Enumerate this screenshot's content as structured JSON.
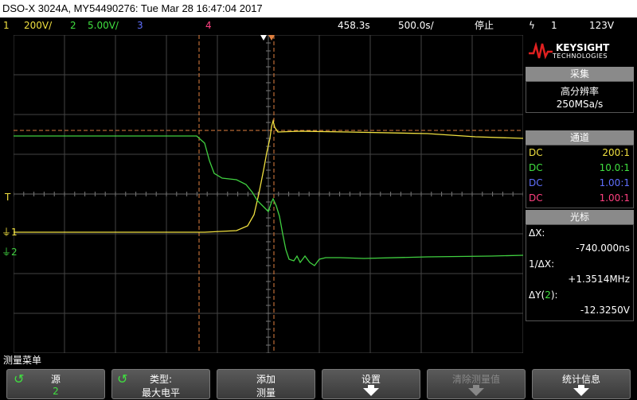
{
  "title_bar": "DSO-X 3024A, MY54490276: Tue Mar 28 16:47:04 2017",
  "status": {
    "ch1_num": "1",
    "ch1_scale": "200V/",
    "ch2_num": "2",
    "ch2_scale": "5.00V/",
    "ch3_num": "3",
    "ch4_num": "4",
    "time_delay": "458.3s",
    "time_scale": "500.0s/",
    "run_state": "停止",
    "trigger_icon": "trigger-edge-icon",
    "trigger_ch": "1",
    "trigger_level": "123V"
  },
  "brand": {
    "name": "KEYSIGHT",
    "sub": "TECHNOLOGIES"
  },
  "acquire": {
    "header": "采集",
    "mode": "高分辨率",
    "rate": "250MSa/s"
  },
  "channels": {
    "header": "通道",
    "rows": [
      {
        "coupling": "DC",
        "probe": "200:1",
        "color": "#f0e040"
      },
      {
        "coupling": "DC",
        "probe": "10.0:1",
        "color": "#40e040"
      },
      {
        "coupling": "DC",
        "probe": "1.00:1",
        "color": "#6070ff"
      },
      {
        "coupling": "DC",
        "probe": "1.00:1",
        "color": "#ff4080"
      }
    ]
  },
  "cursors": {
    "header": "光标",
    "dx_label": "ΔX:",
    "dx_value": "-740.000ns",
    "inv_dx_label": "1/ΔX:",
    "inv_dx_value": "+1.3514MHz",
    "dy_label_pre": "ΔY(",
    "dy_label_ch": "2",
    "dy_label_post": "):",
    "dy_value": "-12.3250V"
  },
  "waveform": {
    "ch1_label": "1",
    "ch2_label": "2",
    "trigger_marker": "T",
    "ch1_color": "#f0e040",
    "ch2_color": "#40d040",
    "cursor_color": "#e08040"
  },
  "menu": {
    "title": "测量菜单",
    "keys": [
      {
        "line1": "源",
        "line2": "2"
      },
      {
        "line1": "类型:",
        "line2": "最大电平"
      },
      {
        "line1": "添加",
        "line2": "测量"
      },
      {
        "line1": "设置",
        "line2": ""
      },
      {
        "line1": "清除测量值",
        "line2": ""
      },
      {
        "line1": "统计信息",
        "line2": ""
      }
    ]
  }
}
